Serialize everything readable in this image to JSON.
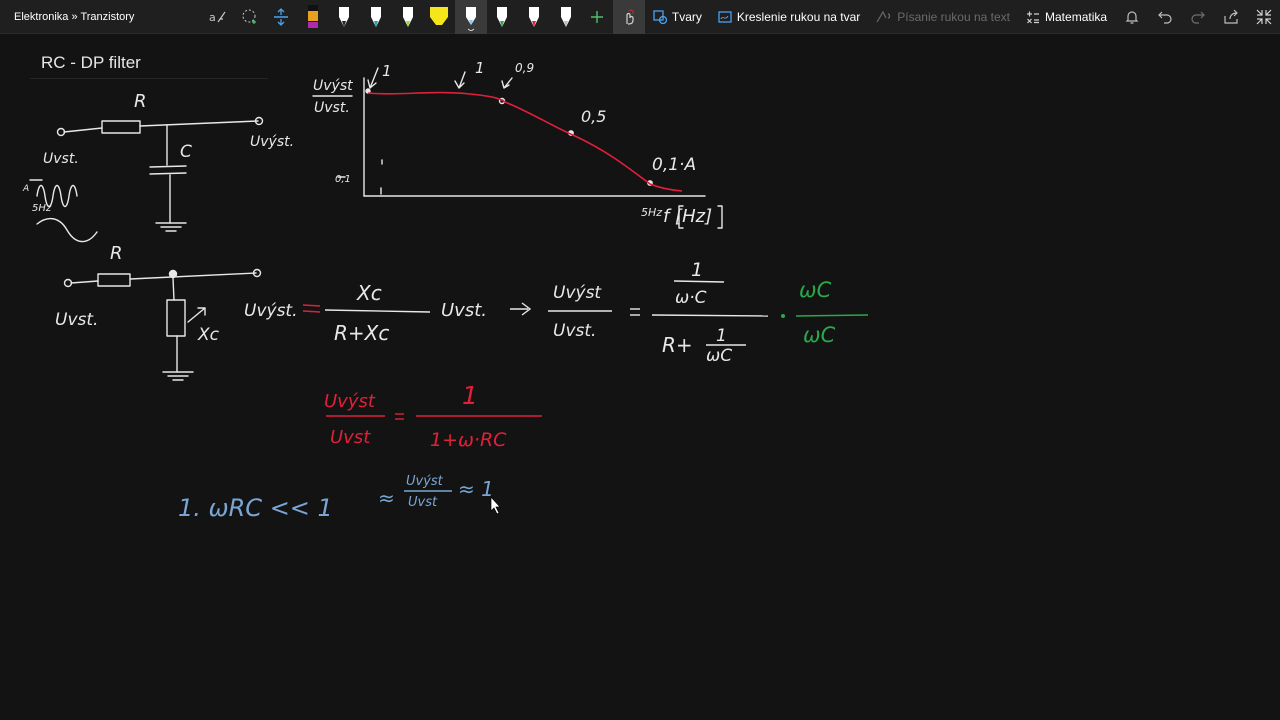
{
  "breadcrumb": "Elektronika » Tranzistory",
  "toolbar": {
    "shapes_label": "Tvary",
    "ink_to_shape_label": "Kreslenie rukou na tvar",
    "ink_to_text_label": "Písanie rukou na text",
    "math_label": "Matematika",
    "pens": [
      {
        "name": "pen-black-magenta",
        "color": "#b02ab0"
      },
      {
        "name": "pen-white",
        "color": "#ffffff"
      },
      {
        "name": "pen-teal",
        "color": "#1aa3a3"
      },
      {
        "name": "pen-green",
        "color": "#9cd13b"
      },
      {
        "name": "pen-yellow-highlighter",
        "color": "#f5e61b"
      },
      {
        "name": "pen-lightblue",
        "color": "#8ec3f5"
      },
      {
        "name": "pen-green-dark",
        "color": "#2aa84a"
      },
      {
        "name": "pen-red",
        "color": "#e0203a"
      },
      {
        "name": "pen-white-2",
        "color": "#ffffff"
      }
    ]
  },
  "page": {
    "title": "RC - DP filter"
  },
  "notes": {
    "c1_R": "R",
    "c1_C": "C",
    "c1_Uvst": "Uvst.",
    "c1_Uvyst": "Uvýst.",
    "c1_sig_label": "A",
    "c1_freq": "5Hz",
    "c2_R": "R",
    "c2_Uvst": "Uvst.",
    "c2_Xc": "Xc",
    "graph_ylabel_top": "Uvýst",
    "graph_ylabel_bot": "Uvst.",
    "graph_y01": "0,1",
    "graph_a1": "1",
    "graph_a2": "1",
    "graph_a3": "0,9",
    "graph_p05": "0,5",
    "graph_p01A": "0,1·A",
    "graph_x5": "5Hz",
    "graph_xlabel": "f [Hz]",
    "eq1_lhs": "Uvýst.",
    "eq1_num": "Xc",
    "eq1_den": "R+Xc",
    "eq1_tail": "Uvst.",
    "eq2_num": "Uvýst",
    "eq2_den": "Uvst.",
    "eq2_rnum_top": "1",
    "eq2_rnum_bot": "ω·C",
    "eq2_rden": "R+",
    "eq2_rden_frac_top": "1",
    "eq2_rden_frac_bot": "ωC",
    "eq2_green_top": "ωC",
    "eq2_green_bot": "ωC",
    "eq3_num": "Uvýst",
    "eq3_den": "Uvst",
    "eq3_rnum": "1",
    "eq3_rden": "1+ω·RC",
    "line4_a": "1.  ωRC << 1",
    "line4_frac_top": "Uvýst",
    "line4_frac_bot": "Uvst",
    "line4_end": "≈ 1"
  }
}
